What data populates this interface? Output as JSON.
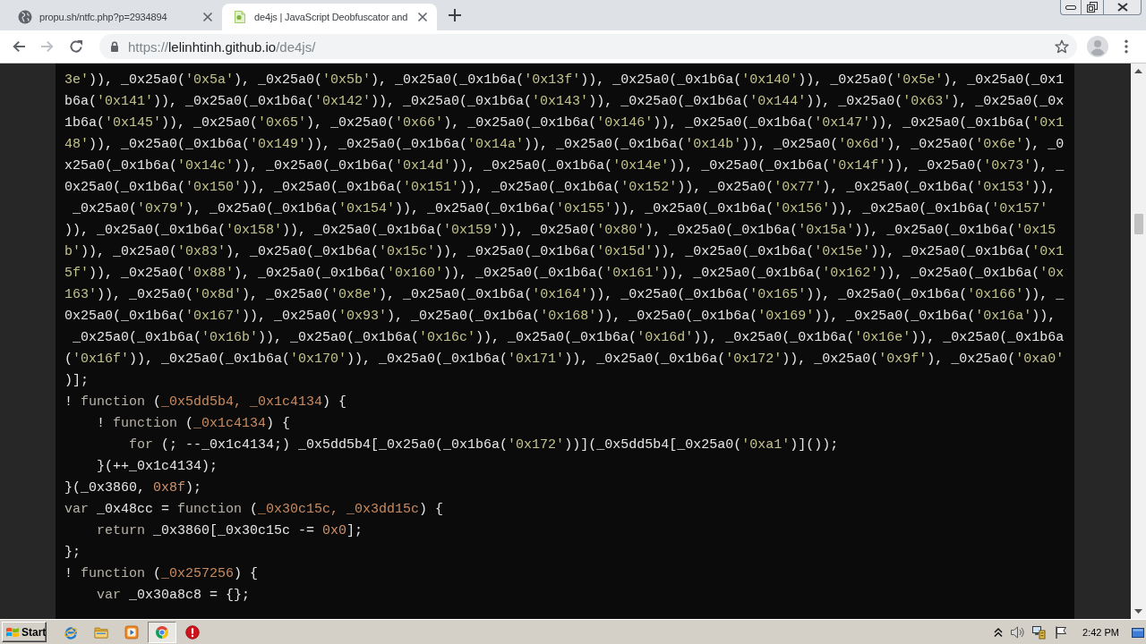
{
  "browser": {
    "tabs": [
      {
        "title": "propu.sh/ntfc.php?p=2934894",
        "selected": false
      },
      {
        "title": "de4js | JavaScript Deobfuscator and",
        "selected": true
      }
    ],
    "nav_buttons": [
      {
        "kind": "back",
        "disabled": false
      },
      {
        "kind": "forward",
        "disabled": true
      },
      {
        "kind": "reload",
        "disabled": false
      }
    ],
    "url": {
      "scheme": "https://",
      "host": "lelinhtinh.github.io",
      "path": "/de4js/"
    }
  },
  "code": {
    "lines": [
      [
        {
          "kind": "string",
          "text": "3e'"
        },
        {
          "kind": "text",
          "text": ")), _0x25a0("
        },
        {
          "kind": "string",
          "text": "'0x5a'"
        },
        {
          "kind": "text",
          "text": "), _0x25a0("
        },
        {
          "kind": "string",
          "text": "'0x5b'"
        },
        {
          "kind": "text",
          "text": "), _0x25a0(_0x1b6a("
        },
        {
          "kind": "string",
          "text": "'0x13f'"
        },
        {
          "kind": "text",
          "text": ")), _0x25a0(_0x1b6a("
        },
        {
          "kind": "string",
          "text": "'0x140'"
        },
        {
          "kind": "text",
          "text": ")), _0x25a0("
        },
        {
          "kind": "string",
          "text": "'0x5e'"
        },
        {
          "kind": "text",
          "text": "), _0x25a0(_0x1"
        }
      ],
      [
        {
          "kind": "text",
          "text": "b6a("
        },
        {
          "kind": "string",
          "text": "'0x141'"
        },
        {
          "kind": "text",
          "text": ")), _0x25a0(_0x1b6a("
        },
        {
          "kind": "string",
          "text": "'0x142'"
        },
        {
          "kind": "text",
          "text": ")), _0x25a0(_0x1b6a("
        },
        {
          "kind": "string",
          "text": "'0x143'"
        },
        {
          "kind": "text",
          "text": ")), _0x25a0(_0x1b6a("
        },
        {
          "kind": "string",
          "text": "'0x144'"
        },
        {
          "kind": "text",
          "text": ")), _0x25a0("
        },
        {
          "kind": "string",
          "text": "'0x63'"
        },
        {
          "kind": "text",
          "text": "), _0x25a0(_0x"
        }
      ],
      [
        {
          "kind": "text",
          "text": "1b6a("
        },
        {
          "kind": "string",
          "text": "'0x145'"
        },
        {
          "kind": "text",
          "text": ")), _0x25a0("
        },
        {
          "kind": "string",
          "text": "'0x65'"
        },
        {
          "kind": "text",
          "text": "), _0x25a0("
        },
        {
          "kind": "string",
          "text": "'0x66'"
        },
        {
          "kind": "text",
          "text": "), _0x25a0(_0x1b6a("
        },
        {
          "kind": "string",
          "text": "'0x146'"
        },
        {
          "kind": "text",
          "text": ")), _0x25a0(_0x1b6a("
        },
        {
          "kind": "string",
          "text": "'0x147'"
        },
        {
          "kind": "text",
          "text": ")), _0x25a0(_0x1b6a("
        },
        {
          "kind": "string",
          "text": "'0x1"
        }
      ],
      [
        {
          "kind": "string",
          "text": "48'"
        },
        {
          "kind": "text",
          "text": ")), _0x25a0(_0x1b6a("
        },
        {
          "kind": "string",
          "text": "'0x149'"
        },
        {
          "kind": "text",
          "text": ")), _0x25a0(_0x1b6a("
        },
        {
          "kind": "string",
          "text": "'0x14a'"
        },
        {
          "kind": "text",
          "text": ")), _0x25a0(_0x1b6a("
        },
        {
          "kind": "string",
          "text": "'0x14b'"
        },
        {
          "kind": "text",
          "text": ")), _0x25a0("
        },
        {
          "kind": "string",
          "text": "'0x6d'"
        },
        {
          "kind": "text",
          "text": "), _0x25a0("
        },
        {
          "kind": "string",
          "text": "'0x6e'"
        },
        {
          "kind": "text",
          "text": "), _0"
        }
      ],
      [
        {
          "kind": "text",
          "text": "x25a0(_0x1b6a("
        },
        {
          "kind": "string",
          "text": "'0x14c'"
        },
        {
          "kind": "text",
          "text": ")), _0x25a0(_0x1b6a("
        },
        {
          "kind": "string",
          "text": "'0x14d'"
        },
        {
          "kind": "text",
          "text": ")), _0x25a0(_0x1b6a("
        },
        {
          "kind": "string",
          "text": "'0x14e'"
        },
        {
          "kind": "text",
          "text": ")), _0x25a0(_0x1b6a("
        },
        {
          "kind": "string",
          "text": "'0x14f'"
        },
        {
          "kind": "text",
          "text": ")), _0x25a0("
        },
        {
          "kind": "string",
          "text": "'0x73'"
        },
        {
          "kind": "text",
          "text": "), _"
        }
      ],
      [
        {
          "kind": "text",
          "text": "0x25a0(_0x1b6a("
        },
        {
          "kind": "string",
          "text": "'0x150'"
        },
        {
          "kind": "text",
          "text": ")), _0x25a0(_0x1b6a("
        },
        {
          "kind": "string",
          "text": "'0x151'"
        },
        {
          "kind": "text",
          "text": ")), _0x25a0(_0x1b6a("
        },
        {
          "kind": "string",
          "text": "'0x152'"
        },
        {
          "kind": "text",
          "text": ")), _0x25a0("
        },
        {
          "kind": "string",
          "text": "'0x77'"
        },
        {
          "kind": "text",
          "text": "), _0x25a0(_0x1b6a("
        },
        {
          "kind": "string",
          "text": "'0x153'"
        },
        {
          "kind": "text",
          "text": ")),"
        }
      ],
      [
        {
          "kind": "text",
          "text": " _0x25a0("
        },
        {
          "kind": "string",
          "text": "'0x79'"
        },
        {
          "kind": "text",
          "text": "), _0x25a0(_0x1b6a("
        },
        {
          "kind": "string",
          "text": "'0x154'"
        },
        {
          "kind": "text",
          "text": ")), _0x25a0(_0x1b6a("
        },
        {
          "kind": "string",
          "text": "'0x155'"
        },
        {
          "kind": "text",
          "text": ")), _0x25a0(_0x1b6a("
        },
        {
          "kind": "string",
          "text": "'0x156'"
        },
        {
          "kind": "text",
          "text": ")), _0x25a0(_0x1b6a("
        },
        {
          "kind": "string",
          "text": "'0x157'"
        }
      ],
      [
        {
          "kind": "text",
          "text": ")), _0x25a0(_0x1b6a("
        },
        {
          "kind": "string",
          "text": "'0x158'"
        },
        {
          "kind": "text",
          "text": ")), _0x25a0(_0x1b6a("
        },
        {
          "kind": "string",
          "text": "'0x159'"
        },
        {
          "kind": "text",
          "text": ")), _0x25a0("
        },
        {
          "kind": "string",
          "text": "'0x80'"
        },
        {
          "kind": "text",
          "text": "), _0x25a0(_0x1b6a("
        },
        {
          "kind": "string",
          "text": "'0x15a'"
        },
        {
          "kind": "text",
          "text": ")), _0x25a0(_0x1b6a("
        },
        {
          "kind": "string",
          "text": "'0x15"
        }
      ],
      [
        {
          "kind": "string",
          "text": "b'"
        },
        {
          "kind": "text",
          "text": ")), _0x25a0("
        },
        {
          "kind": "string",
          "text": "'0x83'"
        },
        {
          "kind": "text",
          "text": "), _0x25a0(_0x1b6a("
        },
        {
          "kind": "string",
          "text": "'0x15c'"
        },
        {
          "kind": "text",
          "text": ")), _0x25a0(_0x1b6a("
        },
        {
          "kind": "string",
          "text": "'0x15d'"
        },
        {
          "kind": "text",
          "text": ")), _0x25a0(_0x1b6a("
        },
        {
          "kind": "string",
          "text": "'0x15e'"
        },
        {
          "kind": "text",
          "text": ")), _0x25a0(_0x1b6a("
        },
        {
          "kind": "string",
          "text": "'0x1"
        }
      ],
      [
        {
          "kind": "string",
          "text": "5f'"
        },
        {
          "kind": "text",
          "text": ")), _0x25a0("
        },
        {
          "kind": "string",
          "text": "'0x88'"
        },
        {
          "kind": "text",
          "text": "), _0x25a0(_0x1b6a("
        },
        {
          "kind": "string",
          "text": "'0x160'"
        },
        {
          "kind": "text",
          "text": ")), _0x25a0(_0x1b6a("
        },
        {
          "kind": "string",
          "text": "'0x161'"
        },
        {
          "kind": "text",
          "text": ")), _0x25a0(_0x1b6a("
        },
        {
          "kind": "string",
          "text": "'0x162'"
        },
        {
          "kind": "text",
          "text": ")), _0x25a0(_0x1b6a("
        },
        {
          "kind": "string",
          "text": "'0x"
        }
      ],
      [
        {
          "kind": "string",
          "text": "163'"
        },
        {
          "kind": "text",
          "text": ")), _0x25a0("
        },
        {
          "kind": "string",
          "text": "'0x8d'"
        },
        {
          "kind": "text",
          "text": "), _0x25a0("
        },
        {
          "kind": "string",
          "text": "'0x8e'"
        },
        {
          "kind": "text",
          "text": "), _0x25a0(_0x1b6a("
        },
        {
          "kind": "string",
          "text": "'0x164'"
        },
        {
          "kind": "text",
          "text": ")), _0x25a0(_0x1b6a("
        },
        {
          "kind": "string",
          "text": "'0x165'"
        },
        {
          "kind": "text",
          "text": ")), _0x25a0(_0x1b6a("
        },
        {
          "kind": "string",
          "text": "'0x166'"
        },
        {
          "kind": "text",
          "text": ")), _"
        }
      ],
      [
        {
          "kind": "text",
          "text": "0x25a0(_0x1b6a("
        },
        {
          "kind": "string",
          "text": "'0x167'"
        },
        {
          "kind": "text",
          "text": ")), _0x25a0("
        },
        {
          "kind": "string",
          "text": "'0x93'"
        },
        {
          "kind": "text",
          "text": "), _0x25a0(_0x1b6a("
        },
        {
          "kind": "string",
          "text": "'0x168'"
        },
        {
          "kind": "text",
          "text": ")), _0x25a0(_0x1b6a("
        },
        {
          "kind": "string",
          "text": "'0x169'"
        },
        {
          "kind": "text",
          "text": ")), _0x25a0(_0x1b6a("
        },
        {
          "kind": "string",
          "text": "'0x16a'"
        },
        {
          "kind": "text",
          "text": ")),"
        }
      ],
      [
        {
          "kind": "text",
          "text": " _0x25a0(_0x1b6a("
        },
        {
          "kind": "string",
          "text": "'0x16b'"
        },
        {
          "kind": "text",
          "text": ")), _0x25a0(_0x1b6a("
        },
        {
          "kind": "string",
          "text": "'0x16c'"
        },
        {
          "kind": "text",
          "text": ")), _0x25a0(_0x1b6a("
        },
        {
          "kind": "string",
          "text": "'0x16d'"
        },
        {
          "kind": "text",
          "text": ")), _0x25a0(_0x1b6a("
        },
        {
          "kind": "string",
          "text": "'0x16e'"
        },
        {
          "kind": "text",
          "text": ")), _0x25a0(_0x1b6a"
        }
      ],
      [
        {
          "kind": "text",
          "text": "("
        },
        {
          "kind": "string",
          "text": "'0x16f'"
        },
        {
          "kind": "text",
          "text": ")), _0x25a0(_0x1b6a("
        },
        {
          "kind": "string",
          "text": "'0x170'"
        },
        {
          "kind": "text",
          "text": ")), _0x25a0(_0x1b6a("
        },
        {
          "kind": "string",
          "text": "'0x171'"
        },
        {
          "kind": "text",
          "text": ")), _0x25a0(_0x1b6a("
        },
        {
          "kind": "string",
          "text": "'0x172'"
        },
        {
          "kind": "text",
          "text": ")), _0x25a0("
        },
        {
          "kind": "string",
          "text": "'0x9f'"
        },
        {
          "kind": "text",
          "text": "), _0x25a0("
        },
        {
          "kind": "string",
          "text": "'0xa0'"
        }
      ],
      [
        {
          "kind": "text",
          "text": ")];"
        }
      ],
      [
        {
          "kind": "text",
          "text": "! "
        },
        {
          "kind": "keyword",
          "text": "function"
        },
        {
          "kind": "text",
          "text": " ("
        },
        {
          "kind": "param",
          "text": "_0x5dd5b4, _0x1c4134"
        },
        {
          "kind": "text",
          "text": ") {"
        }
      ],
      [
        {
          "kind": "text",
          "text": "    ! "
        },
        {
          "kind": "keyword",
          "text": "function"
        },
        {
          "kind": "text",
          "text": " ("
        },
        {
          "kind": "param",
          "text": "_0x1c4134"
        },
        {
          "kind": "text",
          "text": ") {"
        }
      ],
      [
        {
          "kind": "keyword",
          "text": "        for"
        },
        {
          "kind": "text",
          "text": " (; --_0x1c4134;) _0x5dd5b4[_0x25a0(_0x1b6a("
        },
        {
          "kind": "string",
          "text": "'0x172'"
        },
        {
          "kind": "text",
          "text": "))](_0x5dd5b4[_0x25a0("
        },
        {
          "kind": "string",
          "text": "'0xa1'"
        },
        {
          "kind": "text",
          "text": ")]());"
        }
      ],
      [
        {
          "kind": "text",
          "text": "    }(++_0x1c4134);"
        }
      ],
      [
        {
          "kind": "text",
          "text": "}(_0x3860, "
        },
        {
          "kind": "number",
          "text": "0x8f"
        },
        {
          "kind": "text",
          "text": ");"
        }
      ],
      [
        {
          "kind": "keyword",
          "text": "var"
        },
        {
          "kind": "text",
          "text": " _0x48cc = "
        },
        {
          "kind": "keyword",
          "text": "function"
        },
        {
          "kind": "text",
          "text": " ("
        },
        {
          "kind": "param",
          "text": "_0x30c15c, _0x3dd15c"
        },
        {
          "kind": "text",
          "text": ") {"
        }
      ],
      [
        {
          "kind": "keyword",
          "text": "    return"
        },
        {
          "kind": "text",
          "text": " _0x3860[_0x30c15c -= "
        },
        {
          "kind": "number",
          "text": "0x0"
        },
        {
          "kind": "text",
          "text": "];"
        }
      ],
      [
        {
          "kind": "text",
          "text": "};"
        }
      ],
      [
        {
          "kind": "text",
          "text": "! "
        },
        {
          "kind": "keyword",
          "text": "function"
        },
        {
          "kind": "text",
          "text": " ("
        },
        {
          "kind": "param",
          "text": "_0x257256"
        },
        {
          "kind": "text",
          "text": ") {"
        }
      ],
      [
        {
          "kind": "keyword",
          "text": "    var"
        },
        {
          "kind": "text",
          "text": " _0x30a8c8 = {};"
        }
      ]
    ]
  },
  "taskbar": {
    "start_label": "Start",
    "apps": [
      {
        "kind": "ie",
        "selected": false
      },
      {
        "kind": "folder",
        "selected": false
      },
      {
        "kind": "media",
        "selected": false
      },
      {
        "kind": "chrome",
        "selected": true
      },
      {
        "kind": "stop",
        "selected": false
      }
    ],
    "clock": "2:42 PM"
  }
}
